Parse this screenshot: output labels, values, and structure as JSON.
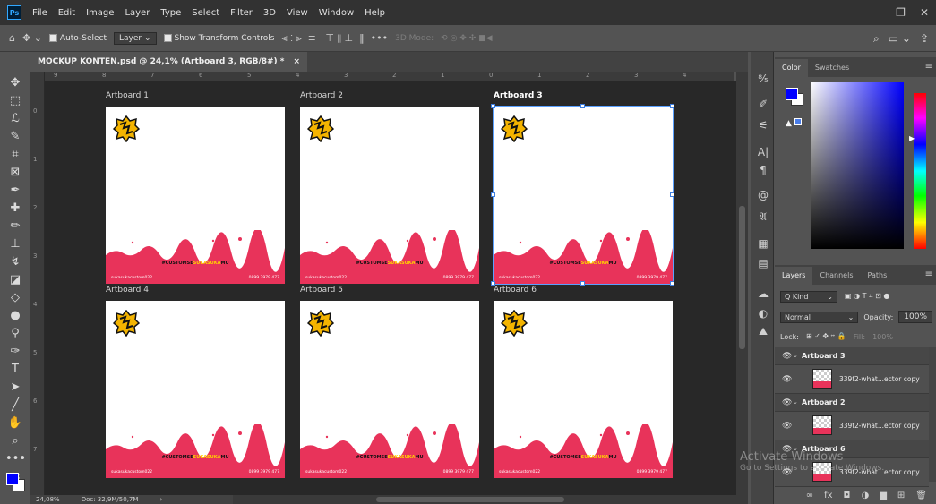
{
  "menu": [
    "File",
    "Edit",
    "Image",
    "Layer",
    "Type",
    "Select",
    "Filter",
    "3D",
    "View",
    "Window",
    "Help"
  ],
  "app_logo": "Ps",
  "options": {
    "auto_select": "Auto-Select",
    "auto_select_target": "Layer",
    "show_transform": "Show Transform Controls",
    "mode_3d": "3D Mode:"
  },
  "document": {
    "tab_title": "MOCKUP KONTEN.psd @ 24,1% (Artboard 3, RGB/8#) *",
    "close": "×",
    "zoom": "24,08%",
    "doc_info": "Doc: 32,9M/50,7M"
  },
  "ruler_h": [
    "9",
    "8",
    "7",
    "6",
    "5",
    "4",
    "3",
    "2",
    "1",
    "0",
    "1",
    "2",
    "3",
    "4"
  ],
  "ruler_v": [
    "0",
    "1",
    "2",
    "3",
    "4",
    "5",
    "6",
    "7"
  ],
  "artboards": [
    {
      "label": "Artboard 1",
      "active": false
    },
    {
      "label": "Artboard 2",
      "active": false
    },
    {
      "label": "Artboard 3",
      "active": true
    },
    {
      "label": "Artboard 4",
      "active": false
    },
    {
      "label": "Artboard 5",
      "active": false
    },
    {
      "label": "Artboard 6",
      "active": false
    }
  ],
  "artboard_content": {
    "tagline_a": "#CUSTOMSE",
    "tagline_b": "SUKASUKA",
    "tagline_c": "MU",
    "social": "sukasukacustom022",
    "phone": "0899 3979 477"
  },
  "color_panel": {
    "tabs": [
      "Color",
      "Swatches"
    ],
    "warning": "▲"
  },
  "layers_panel": {
    "tabs": [
      "Layers",
      "Channels",
      "Paths"
    ],
    "filter_label": "Q Kind",
    "blend_mode": "Normal",
    "opacity_label": "Opacity:",
    "opacity_value": "100%",
    "lock_label": "Lock:",
    "fill_label": "Fill:",
    "fill_value": "100%",
    "rows": [
      {
        "type": "group",
        "name": "Artboard 3"
      },
      {
        "type": "item",
        "name": "339f2-what...ector copy"
      },
      {
        "type": "group",
        "name": "Artboard 2"
      },
      {
        "type": "item",
        "name": "339f2-what...ector copy"
      },
      {
        "type": "group",
        "name": "Artboard 6"
      },
      {
        "type": "item",
        "name": "339f2-what...ector copy"
      }
    ]
  },
  "watermark": {
    "title": "Activate Windows",
    "subtitle": "Go to Settings to activate Windows."
  },
  "colors": {
    "fg": "#0000ff",
    "bg": "#ffffff",
    "accent": "#e8335a",
    "brand_yellow": "#ffd200"
  }
}
